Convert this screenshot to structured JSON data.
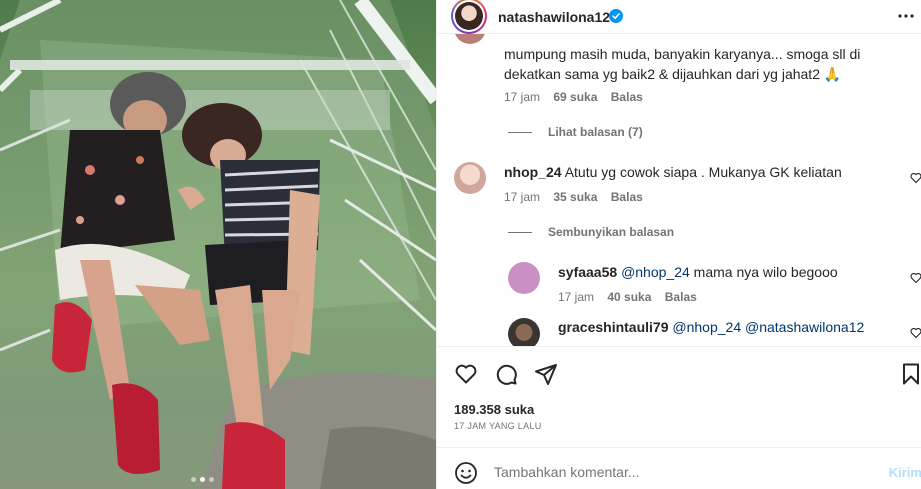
{
  "post": {
    "username": "natashawilona12",
    "verified": true,
    "likes": "189.358 suka",
    "time_ago": "17 JAM YANG LALU"
  },
  "icons": {
    "verified": "verified-badge-icon",
    "more": "more-options-icon",
    "like": "heart-icon",
    "comment": "comment-icon",
    "share": "share-icon",
    "save": "bookmark-icon",
    "emoji": "emoji-icon"
  },
  "colors": {
    "verified": "#0095f6",
    "link": "#00376b",
    "muted": "#737373",
    "post_disabled": "#b2dffc"
  },
  "comments": [
    {
      "username": "",
      "text": "mumpung masih muda, banyakin karyanya... smoga sll di dekatkan sama yg baik2 & dijauhkan dari yg jahat2 🙏",
      "time": "17 jam",
      "likes": "69 suka",
      "reply": "Balas",
      "replies_toggle": "Lihat balasan (7)"
    },
    {
      "username": "nhop_24",
      "text": "Atutu yg cowok siapa . Mukanya GK keliatan",
      "time": "17 jam",
      "likes": "35 suka",
      "reply": "Balas",
      "replies_toggle": "Sembunyikan balasan"
    }
  ],
  "replies": [
    {
      "username": "syfaaa58",
      "mention": "@nhop_24",
      "text": "mama nya wilo begooo",
      "time": "17 jam",
      "likes": "40 suka",
      "reply": "Balas"
    },
    {
      "username": "graceshintauli79",
      "mention": "@nhop_24",
      "mention2": "@natashawilona12",
      "text": ""
    }
  ],
  "composer": {
    "placeholder": "Tambahkan komentar...",
    "post_label": "Kirim"
  },
  "carousel": {
    "count": 3,
    "active": 2
  }
}
